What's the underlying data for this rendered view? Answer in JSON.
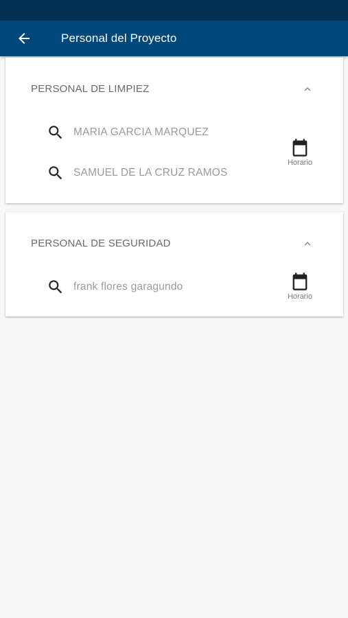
{
  "appbar": {
    "title": "Personal del Proyecto",
    "back_icon": "arrow-back-icon"
  },
  "colors": {
    "statusbar": "#003152",
    "appbar": "#00477a",
    "background": "#f7f7f7",
    "panel": "#ffffff"
  },
  "groups": [
    {
      "title": "PERSONAL DE LIMPIEZ",
      "expanded": true,
      "members": [
        {
          "name": "MARIA GARCIA MARQUEZ",
          "icon": "search-icon"
        },
        {
          "name": "SAMUEL DE LA CRUZ RAMOS",
          "icon": "search-icon"
        }
      ],
      "schedule": {
        "label": "Horario",
        "icon": "calendar-icon"
      }
    },
    {
      "title": "PERSONAL DE SEGURIDAD",
      "expanded": true,
      "members": [
        {
          "name": "frank flores garagundo",
          "icon": "search-icon"
        }
      ],
      "schedule": {
        "label": "Horario",
        "icon": "calendar-icon"
      }
    }
  ]
}
